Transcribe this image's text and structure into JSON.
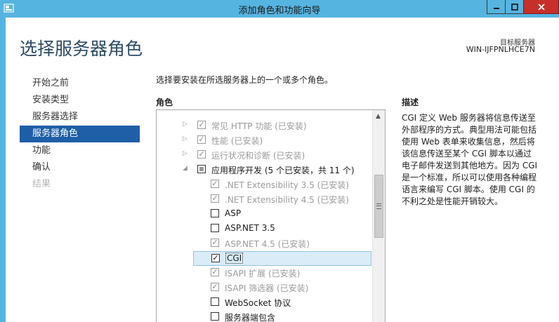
{
  "window": {
    "title": "添加角色和功能向导",
    "minimize_glyph": "—",
    "maximize_glyph": "□",
    "close_glyph": "✕"
  },
  "page": {
    "heading": "选择服务器角色",
    "server_label": "目标服务器",
    "server_name": "WIN-IJFPNLHCE7N"
  },
  "nav": [
    {
      "label": "开始之前",
      "state": "normal"
    },
    {
      "label": "安装类型",
      "state": "normal"
    },
    {
      "label": "服务器选择",
      "state": "normal"
    },
    {
      "label": "服务器角色",
      "state": "active"
    },
    {
      "label": "功能",
      "state": "normal"
    },
    {
      "label": "确认",
      "state": "normal"
    },
    {
      "label": "结果",
      "state": "disabled"
    }
  ],
  "instruction": "选择要安装在所选服务器上的一个或多个角色。",
  "roles_header": "角色",
  "description_header": "描述",
  "description_text": "CGI 定义 Web 服务器将信息传送至外部程序的方式。典型用法可能包括使用 Web 表单来收集信息，然后将该信息传送至某个 CGI 脚本以通过电子邮件发送到其他地方。因为 CGI 是一个标准，所以可以使用各种编程语言来编写 CGI 脚本。使用 CGI 的不利之处是性能开销较大。",
  "roles": [
    {
      "label": "常见 HTTP 功能 (已安装)",
      "level": 1,
      "expander": "▷",
      "check": "checked",
      "enabled": false
    },
    {
      "label": "性能 (已安装)",
      "level": 1,
      "expander": "▷",
      "check": "checked",
      "enabled": false
    },
    {
      "label": "运行状况和诊断 (已安装)",
      "level": 1,
      "expander": "▷",
      "check": "checked",
      "enabled": false
    },
    {
      "label": "应用程序开发 (5 个已安装，共 11 个)",
      "level": 1,
      "expander": "◢",
      "check": "partial",
      "enabled": true
    },
    {
      "label": ".NET Extensibility 3.5 (已安装)",
      "level": 2,
      "expander": "",
      "check": "checked",
      "enabled": false
    },
    {
      "label": ".NET Extensibility 4.5 (已安装)",
      "level": 2,
      "expander": "",
      "check": "checked",
      "enabled": false
    },
    {
      "label": "ASP",
      "level": 2,
      "expander": "",
      "check": "unchecked",
      "enabled": true
    },
    {
      "label": "ASP.NET 3.5",
      "level": 2,
      "expander": "",
      "check": "unchecked",
      "enabled": true
    },
    {
      "label": "ASP.NET 4.5 (已安装)",
      "level": 2,
      "expander": "",
      "check": "checked",
      "enabled": false
    },
    {
      "label": "CGI",
      "level": 2,
      "expander": "",
      "check": "checked",
      "enabled": true,
      "selected": true
    },
    {
      "label": "ISAPI 扩展 (已安装)",
      "level": 2,
      "expander": "",
      "check": "checked",
      "enabled": false
    },
    {
      "label": "ISAPI 筛选器 (已安装)",
      "level": 2,
      "expander": "",
      "check": "checked",
      "enabled": false
    },
    {
      "label": "WebSocket 协议",
      "level": 2,
      "expander": "",
      "check": "unchecked",
      "enabled": true
    },
    {
      "label": "服务器端包含",
      "level": 2,
      "expander": "",
      "check": "unchecked",
      "enabled": true
    }
  ]
}
